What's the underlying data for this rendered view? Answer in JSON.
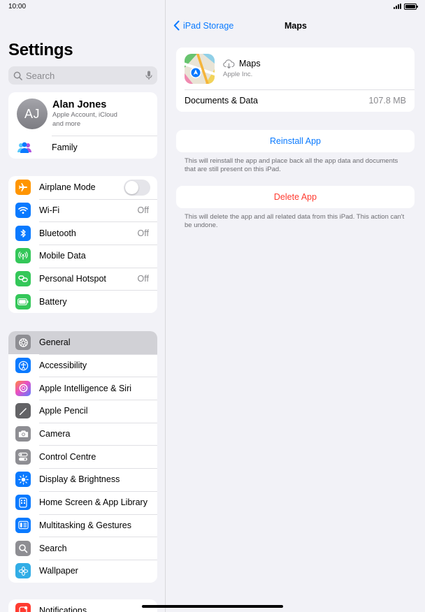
{
  "status": {
    "time": "10:00"
  },
  "sidebar": {
    "title": "Settings",
    "search_placeholder": "Search",
    "profile": {
      "initials": "AJ",
      "name": "Alan Jones",
      "subtitle": "Apple Account, iCloud and more"
    },
    "family_label": "Family",
    "connectivity": [
      {
        "label": "Airplane Mode",
        "value": "",
        "icon": "airplane-icon",
        "color": "#ff9500"
      },
      {
        "label": "Wi-Fi",
        "value": "Off",
        "icon": "wifi-icon",
        "color": "#0a7aff"
      },
      {
        "label": "Bluetooth",
        "value": "Off",
        "icon": "bluetooth-icon",
        "color": "#0a7aff"
      },
      {
        "label": "Mobile Data",
        "value": "",
        "icon": "antenna-icon",
        "color": "#34c759"
      },
      {
        "label": "Personal Hotspot",
        "value": "Off",
        "icon": "hotspot-icon",
        "color": "#34c759"
      },
      {
        "label": "Battery",
        "value": "",
        "icon": "battery-icon",
        "color": "#34c759"
      }
    ],
    "general": [
      {
        "label": "General",
        "icon": "gear-icon",
        "color": "#8e8e93"
      },
      {
        "label": "Accessibility",
        "icon": "accessibility-icon",
        "color": "#0a7aff"
      },
      {
        "label": "Apple Intelligence & Siri",
        "icon": "siri-icon",
        "color": "#b25bd6"
      },
      {
        "label": "Apple Pencil",
        "icon": "pencil-icon",
        "color": "#636366"
      },
      {
        "label": "Camera",
        "icon": "camera-icon",
        "color": "#8e8e93"
      },
      {
        "label": "Control Centre",
        "icon": "switches-icon",
        "color": "#8e8e93"
      },
      {
        "label": "Display & Brightness",
        "icon": "sun-icon",
        "color": "#0a7aff"
      },
      {
        "label": "Home Screen & App Library",
        "icon": "home-screen-icon",
        "color": "#0a7aff"
      },
      {
        "label": "Multitasking & Gestures",
        "icon": "multitasking-icon",
        "color": "#0a7aff"
      },
      {
        "label": "Search",
        "icon": "magnifier-icon",
        "color": "#8e8e93"
      },
      {
        "label": "Wallpaper",
        "icon": "flower-icon",
        "color": "#32ade6"
      }
    ],
    "notifications_label": "Notifications"
  },
  "detail": {
    "back_label": "iPad Storage",
    "title": "Maps",
    "app": {
      "name": "Maps",
      "developer": "Apple Inc."
    },
    "documents_label": "Documents & Data",
    "documents_value": "107.8 MB",
    "reinstall_label": "Reinstall App",
    "reinstall_note": "This will reinstall the app and place back all the app data and documents that are still present on this iPad.",
    "delete_label": "Delete App",
    "delete_note": "This will delete the app and all related data from this iPad. This action can't be undone."
  },
  "colors": {
    "accent": "#0a7aff",
    "destructive": "#ff3b30"
  }
}
